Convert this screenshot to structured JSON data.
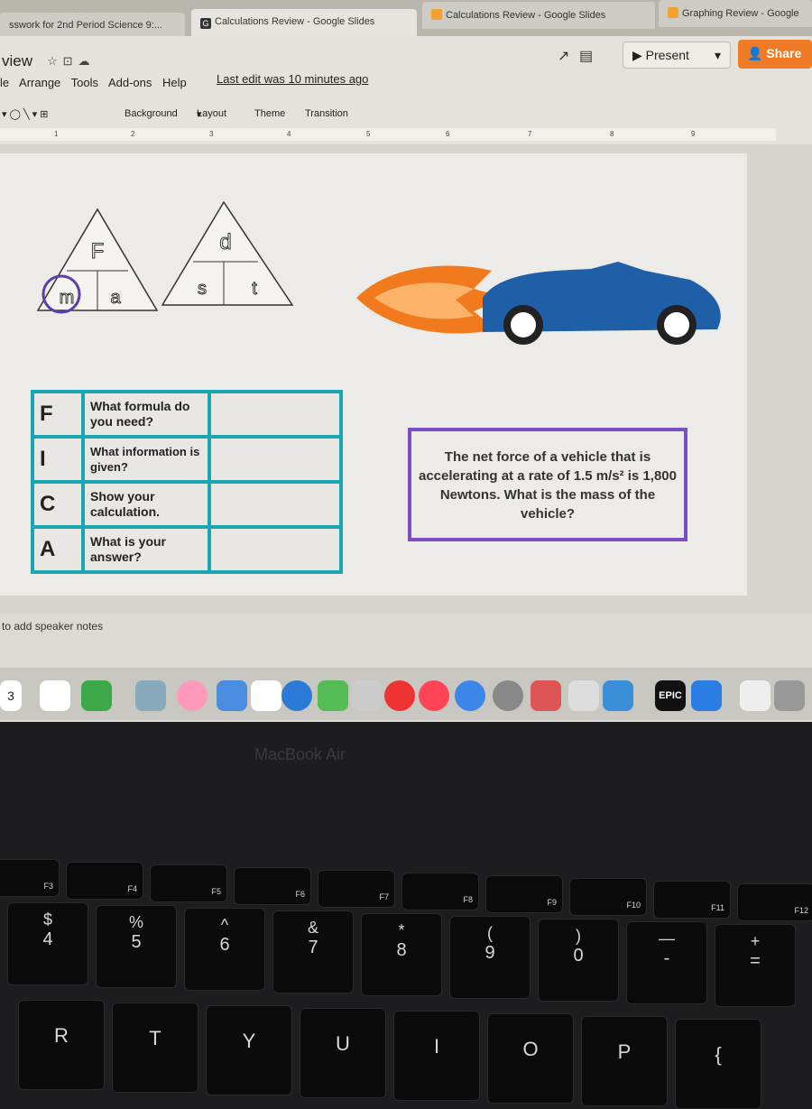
{
  "browser_tabs": [
    {
      "label": "sswork for 2nd Period Science 9:..."
    },
    {
      "label": "Calculations Review - Google Slides",
      "active": true
    },
    {
      "label": "Calculations Review - Google Slides"
    },
    {
      "label": "Graphing Review - Google"
    }
  ],
  "app": {
    "title": "view",
    "menu": [
      "le",
      "Arrange",
      "Tools",
      "Add-ons",
      "Help"
    ],
    "last_edit": "Last edit was 10 minutes ago",
    "present_label": "Present",
    "share_label": "Share",
    "accent": "#f07b26"
  },
  "toolbar": {
    "background": "Background",
    "layout": "Layout",
    "theme": "Theme",
    "transition": "Transition"
  },
  "ruler": [
    "1",
    "2",
    "3",
    "4",
    "5",
    "6",
    "7",
    "8",
    "9"
  ],
  "slide": {
    "triangle1": {
      "top": "F",
      "left": "m",
      "right": "a"
    },
    "triangle2": {
      "top": "d",
      "left": "s",
      "right": "t"
    },
    "fica": [
      {
        "letter": "F",
        "question": "What formula do you need?"
      },
      {
        "letter": "I",
        "question": "What information is given?"
      },
      {
        "letter": "C",
        "question": "Show your calculation."
      },
      {
        "letter": "A",
        "question": "What is your answer?"
      }
    ],
    "problem": "The net force of a vehicle that is accelerating at a rate of 1.5 m/s² is 1,800 Newtons. What is the mass of the vehicle?",
    "table_color": "#1aa6b0",
    "box_color": "#7a4fc0"
  },
  "speaker_notes": "to add speaker notes",
  "dock": {
    "calendar_day": "3",
    "epic": "EPIC"
  },
  "laptop_label": "MacBook Air",
  "keyboard": {
    "fn_row": [
      "F3",
      "F4",
      "F5",
      "F6",
      "F7",
      "F8",
      "F9",
      "F10",
      "F11",
      "F12"
    ],
    "num_row": [
      [
        "$",
        "4"
      ],
      [
        "%",
        "5"
      ],
      [
        "^",
        "6"
      ],
      [
        "&",
        "7"
      ],
      [
        "*",
        "8"
      ],
      [
        "(",
        "9"
      ],
      [
        ")",
        "0"
      ],
      [
        "—",
        "-"
      ],
      [
        "+",
        "="
      ]
    ],
    "letter_row": [
      "R",
      "T",
      "Y",
      "U",
      "I",
      "O",
      "P",
      "{"
    ]
  }
}
